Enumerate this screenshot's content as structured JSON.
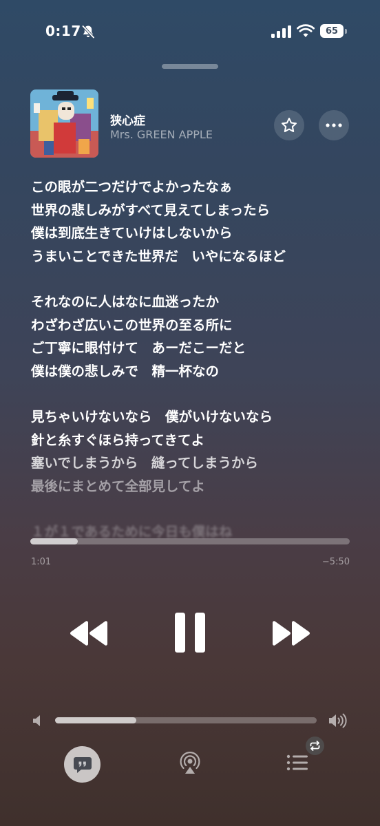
{
  "status_bar": {
    "time": "0:17",
    "battery": "65",
    "icons": [
      "bell-slash-icon",
      "cellular-signal-icon",
      "wifi-icon",
      "battery-icon"
    ]
  },
  "now_playing": {
    "title": "狭心症",
    "artist": "Mrs. GREEN APPLE",
    "artwork": "album-artwork",
    "favorite_icon": "star-icon",
    "more_icon": "ellipsis-icon"
  },
  "lyrics": [
    [
      "この眼が二つだけでよかったなぁ",
      "世界の悲しみがすべて見えてしまったら",
      "僕は到底生きていけはしないから",
      "うまいことできた世界だ　いやになるほど"
    ],
    [
      "それなのに人はなに血迷ったか",
      "わざわざ広いこの世界の至る所に",
      "ご丁寧に眼付けて　あーだこーだと",
      "僕は僕の悲しみで　精一杯なの"
    ],
    [
      "見ちゃいけないなら　僕がいけないなら",
      "針と糸すぐほら持ってきてよ",
      "塞いでしまうから　縫ってしまうから",
      "最後にまとめて全部見してよ"
    ],
    [
      "１が１であるために今日も僕はね"
    ]
  ],
  "playback": {
    "elapsed": "1:01",
    "remaining": "−5:50",
    "progress": 0.149,
    "volume": 0.31,
    "state_icon": "pause-icon"
  },
  "colors": {
    "background_top": "#2f4a66",
    "background_bottom": "#3f302c",
    "text_primary": "#ffffff",
    "text_secondary": "rgba(255,255,255,0.55)"
  }
}
